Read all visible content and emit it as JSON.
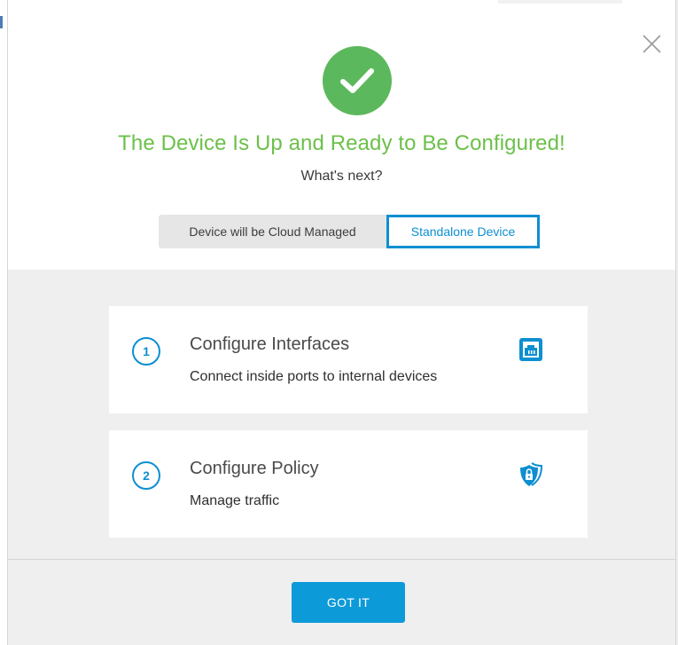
{
  "dialog": {
    "title": "The Device Is Up and Ready to Be Configured!",
    "subtitle": "What's next?",
    "success_icon": "check-circle-icon",
    "close_icon": "close-icon"
  },
  "mode_toggle": {
    "options": [
      {
        "label": "Device will be Cloud Managed",
        "selected": false
      },
      {
        "label": "Standalone Device",
        "selected": true
      }
    ]
  },
  "steps": [
    {
      "number": "1",
      "title": "Configure Interfaces",
      "description": "Connect inside ports to internal devices",
      "icon": "ethernet-port-icon"
    },
    {
      "number": "2",
      "title": "Configure Policy",
      "description": "Manage traffic",
      "icon": "shield-lock-icon"
    }
  ],
  "footer": {
    "confirm_label": "GOT IT"
  },
  "colors": {
    "success_green": "#5cb85c",
    "title_green": "#6cc04a",
    "accent_blue": "#0d8fd1",
    "button_blue": "#0d9ad9",
    "panel_gray": "#efefef"
  }
}
